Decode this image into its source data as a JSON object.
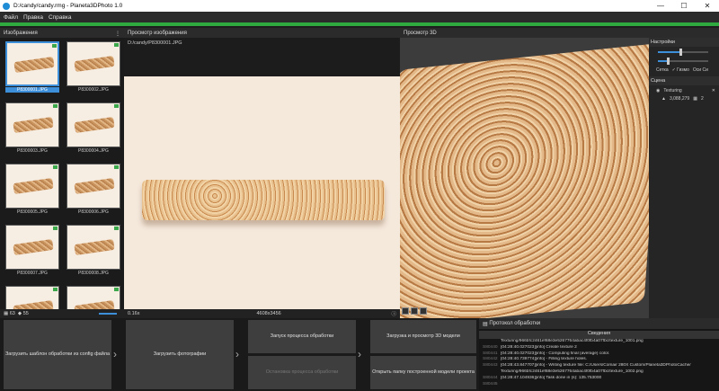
{
  "window": {
    "title": "D:/candy/candy.rmg - Planeta3DPhoto 1.0"
  },
  "menu": [
    "Файл",
    "Правка",
    "Справка"
  ],
  "panels": {
    "images": "Изображения",
    "image_preview": "Просмотр изображения",
    "preview3d": "Просмотр 3D"
  },
  "images_menu": "⋮",
  "image_path": "D:/candy/P8300001.JPG",
  "thumbnails": [
    "P8300001.JPG",
    "P8300002.JPG",
    "P8300003.JPG",
    "P8300004.JPG",
    "P8300005.JPG",
    "P8300006.JPG",
    "P8300007.JPG",
    "P8300008.JPG",
    "",
    ""
  ],
  "selected_thumbnail": 0,
  "left_footer": {
    "count1": "63",
    "count2": "55"
  },
  "preview_footer": {
    "zoom": "0.16x",
    "size": "4608x3456"
  },
  "settings": {
    "title": "Настройки",
    "slider1": 0.45,
    "slider2": 0.2,
    "options": [
      "Сетка",
      "✓ Гизмо",
      "Оси Си"
    ]
  },
  "scene": {
    "title": "Сцена",
    "item": "Texturing",
    "count": "3,088,279",
    "count2": "2"
  },
  "workflow": {
    "load_template": "Загрузить шаблон обработки из config файла",
    "load_photos": "Загрузить фотографии",
    "start_processing": "Запуск процесса обработки",
    "stop_processing": "Остановка процесса обработки",
    "load_view_3d": "Загрузка и просмотр 3D модели",
    "open_folder": "Открыть папку построенной модели проекта"
  },
  "log": {
    "title": "Протокол обработки",
    "header": "Сведения",
    "lines": [
      {
        "n": "",
        "t": "Texturing/966bfc2461ef68e3e5267764abac4f0fb4a07fbc/texture_1001.png"
      },
      {
        "n": "S80440",
        "t": "[04:28:40.027023][info] Create texture 2"
      },
      {
        "n": "S80441",
        "t": "[04:28:40.027023][info]    - Computing final (average) color."
      },
      {
        "n": "S80442",
        "t": "[04:28:40.739774][info]    - Filling texture holes."
      },
      {
        "n": "S80443",
        "t": "[04:28:43.847707][info]    - Writing texture file: C:/Users/Comair 280X Custom/Planeta3DPhotoCache/"
      },
      {
        "n": "",
        "t": "Texturing/966bfc2461ef68e3e5267764abac4f0fb4a07fbc/texture_1002.png"
      },
      {
        "n": "S80444",
        "t": "[04:28:47.104936][info] Task done in (s): 135.753000"
      },
      {
        "n": "S80445",
        "t": ""
      }
    ]
  }
}
